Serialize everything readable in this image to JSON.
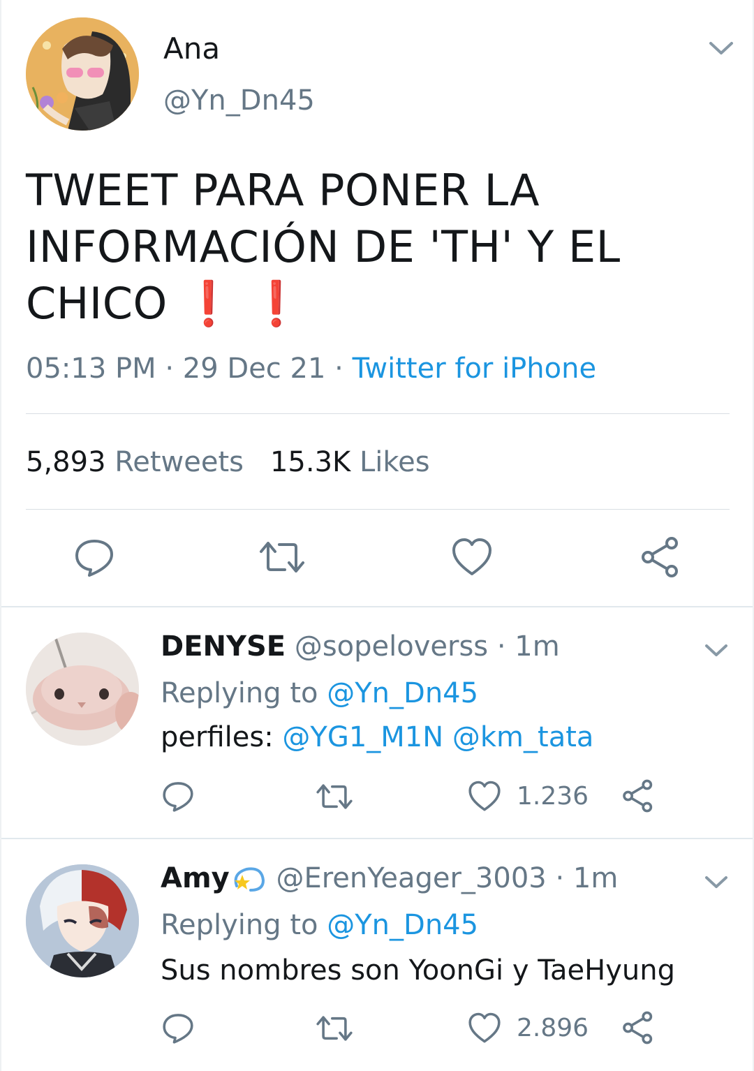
{
  "main": {
    "name": "Ana",
    "handle": "@Yn_Dn45",
    "text": "TWEET PARA PONER LA INFORMACIÓN DE 'TH' Y EL CHICO",
    "text_line1": "TWEET PARA PONER LA",
    "text_line2": "INFORMACIÓN DE 'TH' Y EL",
    "text_line3": "CHICO",
    "emoji": "❗❗",
    "time": "05:13 PM",
    "date": "29 Dec 21",
    "separator": "·",
    "source": "Twitter for iPhone",
    "retweets_count": "5,893",
    "retweets_label": "Retweets",
    "likes_count": "15.3K",
    "likes_label": "Likes"
  },
  "replies": [
    {
      "name": "DENYSE",
      "handle": "@sopeloverss",
      "time_sep": "·",
      "time": "1m",
      "replying_label": "Replying to",
      "replying_to": "@Yn_Dn45",
      "text_prefix": "perfiles:",
      "mention_1": "@YG1_M1N",
      "mention_2": "@km_tata",
      "likes": "1.236"
    },
    {
      "name": "Amy",
      "handle": "@ErenYeager_3003",
      "time_sep": "·",
      "time": "1m",
      "replying_label": "Replying to",
      "replying_to": "@Yn_Dn45",
      "text": "Sus nombres son YoonGi y TaeHyung",
      "likes": "2.896"
    }
  ],
  "icons": {
    "chevron": "chevron-down-icon",
    "reply": "reply-icon",
    "retweet": "retweet-icon",
    "like": "heart-icon",
    "share": "share-icon"
  },
  "colors": {
    "text": "#14171a",
    "secondary": "#657786",
    "link": "#1b95e0",
    "emoji_red": "#e0191f",
    "divider": "#e1e8ed"
  }
}
